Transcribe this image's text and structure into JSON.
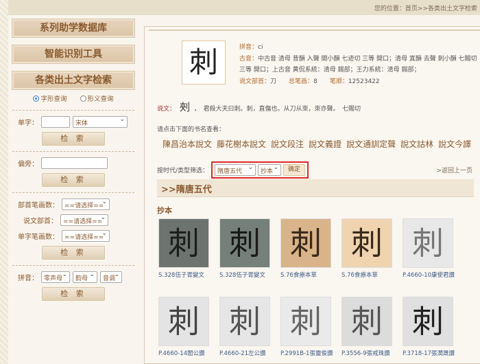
{
  "breadcrumb": "您的位置：首页>>各类出土文字检索",
  "sidebar": {
    "headers": [
      "系列助学数据库",
      "智能识别工具",
      "各类出土文字检索"
    ],
    "radios": [
      "字形查询",
      "形义查询"
    ],
    "single_label": "单字：",
    "font_select": "宋体",
    "search_label": "检 索",
    "radical_label": "偏旁：",
    "bushou_strokes_label": "部首笔画数：",
    "shuowen_bushou_label": "说文部首：",
    "char_strokes_label": "单字笔画数：",
    "please_select": "==请选择==",
    "pinyin_label": "拼音：",
    "initial": "零声母",
    "final": "韵母",
    "tone": "音调"
  },
  "char": {
    "glyph": "刺",
    "pinyin_label": "拼音：",
    "pinyin": "ci",
    "guyin_label": "古音：",
    "guyin": "中古音 清母 昔韻 入聲 開小韻 七迹切 三等 開口；清母 寘韻 去聲 刺小韻 七賜切 三等 開口；上古音 黄侃系統：清母 錫部；王力系統：清母 錫部；",
    "bushou_label": "说文部首：",
    "bushou": "刀",
    "strokes_label": "总笔画：",
    "strokes": "8",
    "order_label": "笔顺：",
    "order": "12523422",
    "shuowen_label": "说文：",
    "seal": "㓨",
    "shuowen_text": "，　君殺大夫曰刺。刺，直傷也。从刀从朿，朿亦聲。　七賜切"
  },
  "hint": "请点击下面的书名查看：",
  "books": [
    "陳昌治本說文",
    "藤花榭本說文",
    "說文段注",
    "說文義證",
    "說文通訓定聲",
    "說文詁林",
    "說文今譯"
  ],
  "filter": {
    "label": "按时代/类型筛选：",
    "era": "隋唐五代",
    "type": "抄本",
    "ok": "确定",
    "back": ">返回上一页"
  },
  "dynasty": ">>隋唐五代",
  "type_heading": "抄本",
  "tiles": [
    {
      "caption": "S.328伍子胥變文",
      "bg": "#6d7470",
      "fg": "#1e1e1e"
    },
    {
      "caption": "S.328伍子胥變文",
      "bg": "#76807a",
      "fg": "#1a1a1a"
    },
    {
      "caption": "S.76食療本草",
      "bg": "#d9b48a",
      "fg": "#3a2a1a"
    },
    {
      "caption": "S.76食療本草",
      "bg": "#f0d4b0",
      "fg": "#3a2a1a"
    },
    {
      "caption": "P.4660-10康使君讚",
      "bg": "#e8e8e8",
      "fg": "#777"
    },
    {
      "caption": "P.4660-14閻公讚",
      "bg": "#e4e4e4",
      "fg": "#444"
    },
    {
      "caption": "P.4660-21左公讚",
      "bg": "#e6e6e6",
      "fg": "#555"
    },
    {
      "caption": "P.2991B-1張靈俊讚",
      "bg": "#eaeaea",
      "fg": "#666"
    },
    {
      "caption": "P.3556-9張戒珠讚",
      "bg": "#dcdcdc",
      "fg": "#555"
    },
    {
      "caption": "P.3718-17張潤晟讚",
      "bg": "#e0e0e0",
      "fg": "#222"
    }
  ]
}
